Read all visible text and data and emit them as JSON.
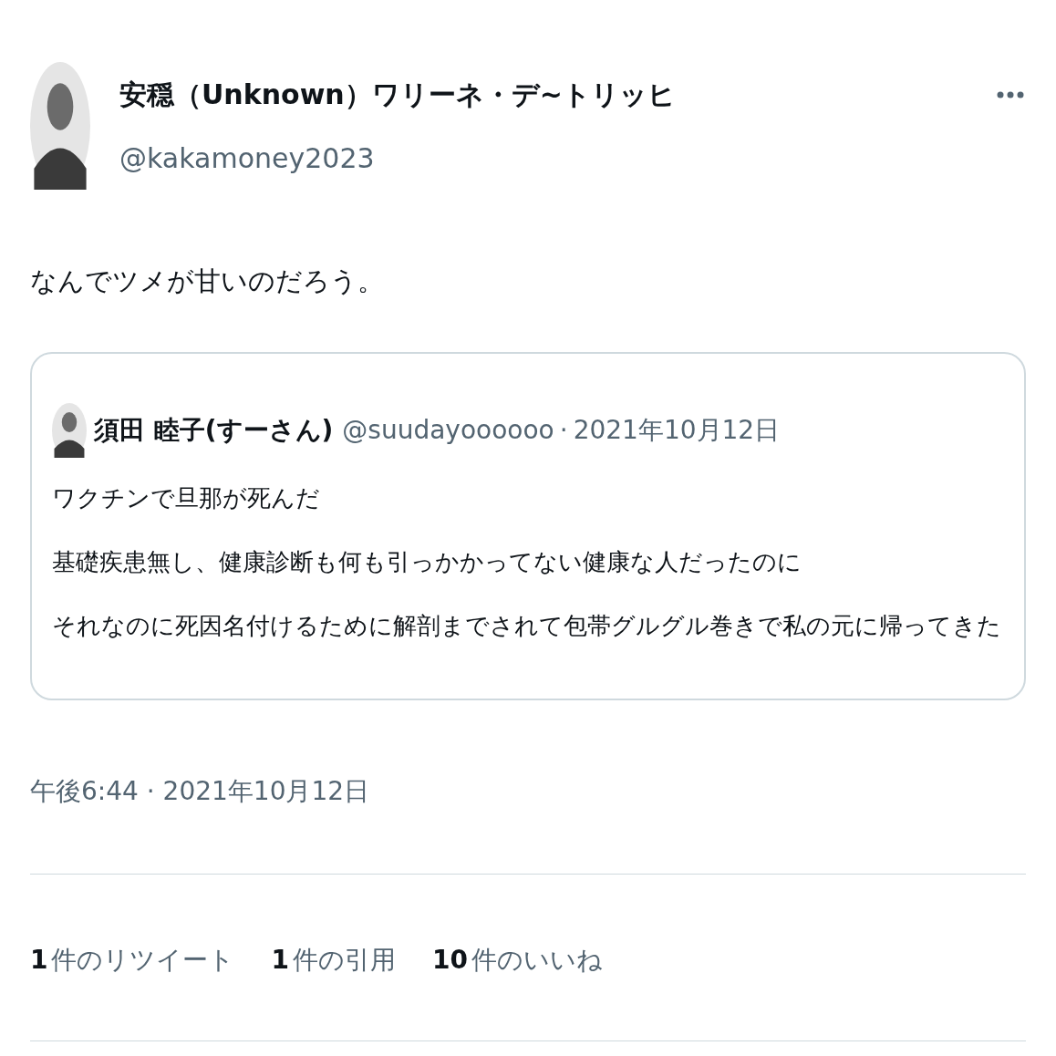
{
  "author": {
    "name": "安穏（Unknown）ワリーネ・デ~トリッヒ",
    "handle": "@kakamoney2023"
  },
  "text": "なんでツメが甘いのだろう。",
  "quote": {
    "name": "須田 睦子(すーさん)",
    "handle": "@suudayoooooo",
    "separator": "·",
    "date": "2021年10月12日",
    "lines": [
      "ワクチンで旦那が死んだ",
      "基礎疾患無し、健康診断も何も引っかかってない健康な人だったのに",
      "それなのに死因名付けるために解剖までされて包帯グルグル巻きで私の元に帰ってきた"
    ]
  },
  "timestamp": "午後6:44 · 2021年10月12日",
  "stats": [
    {
      "count": "1",
      "label": "件のリツイート"
    },
    {
      "count": "1",
      "label": "件の引用"
    },
    {
      "count": "10",
      "label": "件のいいね"
    }
  ]
}
